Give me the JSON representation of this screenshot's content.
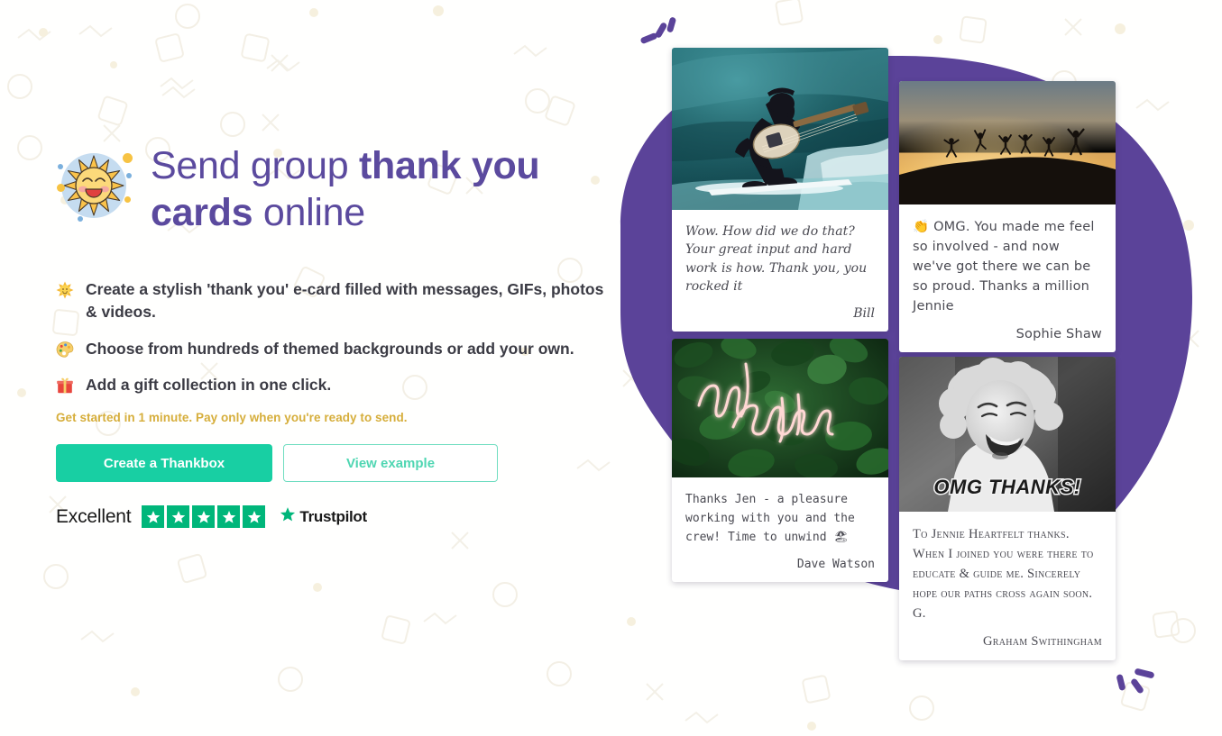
{
  "theme": {
    "purple": "#5b4a9e",
    "blob_purple": "#5b4399",
    "green": "#18cfa3",
    "green_outline": "#6fddc0",
    "gold": "#d6ae3b",
    "trustpilot_green": "#00b67a",
    "body_text": "#3b3b44",
    "page_bg": "#ffffff"
  },
  "hero": {
    "logo_icon": "smiling-sun-icon",
    "headline_parts": [
      {
        "text": "Send group ",
        "bold": false
      },
      {
        "text": "thank you cards",
        "bold": true
      },
      {
        "text": " online",
        "bold": false
      }
    ],
    "headline_plain": "Send group thank you cards online",
    "bullets": [
      {
        "icon": "sun-emoji",
        "glyph": "☀",
        "text": "Create a stylish 'thank you' e-card filled with messages, GIFs, photos & videos."
      },
      {
        "icon": "artist-palette-emoji",
        "glyph": "🎨",
        "text": "Choose from hundreds of themed backgrounds or add your own."
      },
      {
        "icon": "wrapped-gift-emoji",
        "glyph": "🎁",
        "text": "Add a gift collection in one click."
      }
    ],
    "tagline": "Get started in 1 minute. Pay only when you're ready to send.",
    "primary_cta": "Create a Thankbox",
    "secondary_cta": "View example"
  },
  "trustpilot": {
    "rating_word": "Excellent",
    "stars": 5,
    "star_glyph": "★",
    "brand_name": "Trustpilot",
    "brand_icon": "trustpilot-star-icon"
  },
  "testimonials": [
    {
      "id": "card-1",
      "image_alt": "surfer-playing-guitar-gif",
      "quote": "Wow. How did we do that? Your great input and hard work is how. Thank you, you rocked it",
      "author": "Bill"
    },
    {
      "id": "card-2",
      "image_alt": "people-jumping-at-sunset-photo",
      "quote": "👏 OMG. You made me feel so involved - and now we've got there we can be so proud. Thanks a million Jennie",
      "author": "Sophie Shaw"
    },
    {
      "id": "card-3",
      "image_alt": "and-breathe-neon-sign-photo",
      "quote": "Thanks Jen - a pleasure working with you and the crew! Time to unwind 🏖",
      "author": "Dave Watson"
    },
    {
      "id": "card-4",
      "image_alt": "laughing-child-omg-thanks-gif",
      "image_caption": "OMG THANKS!",
      "quote": "To Jennie Heartfelt thanks. When I joined you were there to educate & guide me. Sincerely hope our paths cross again soon. G.",
      "author": "Graham Swithingham"
    }
  ],
  "decorations": {
    "top_left_marks": "three-slanted-dashes",
    "bottom_right_marks": "three-slanted-dashes"
  }
}
